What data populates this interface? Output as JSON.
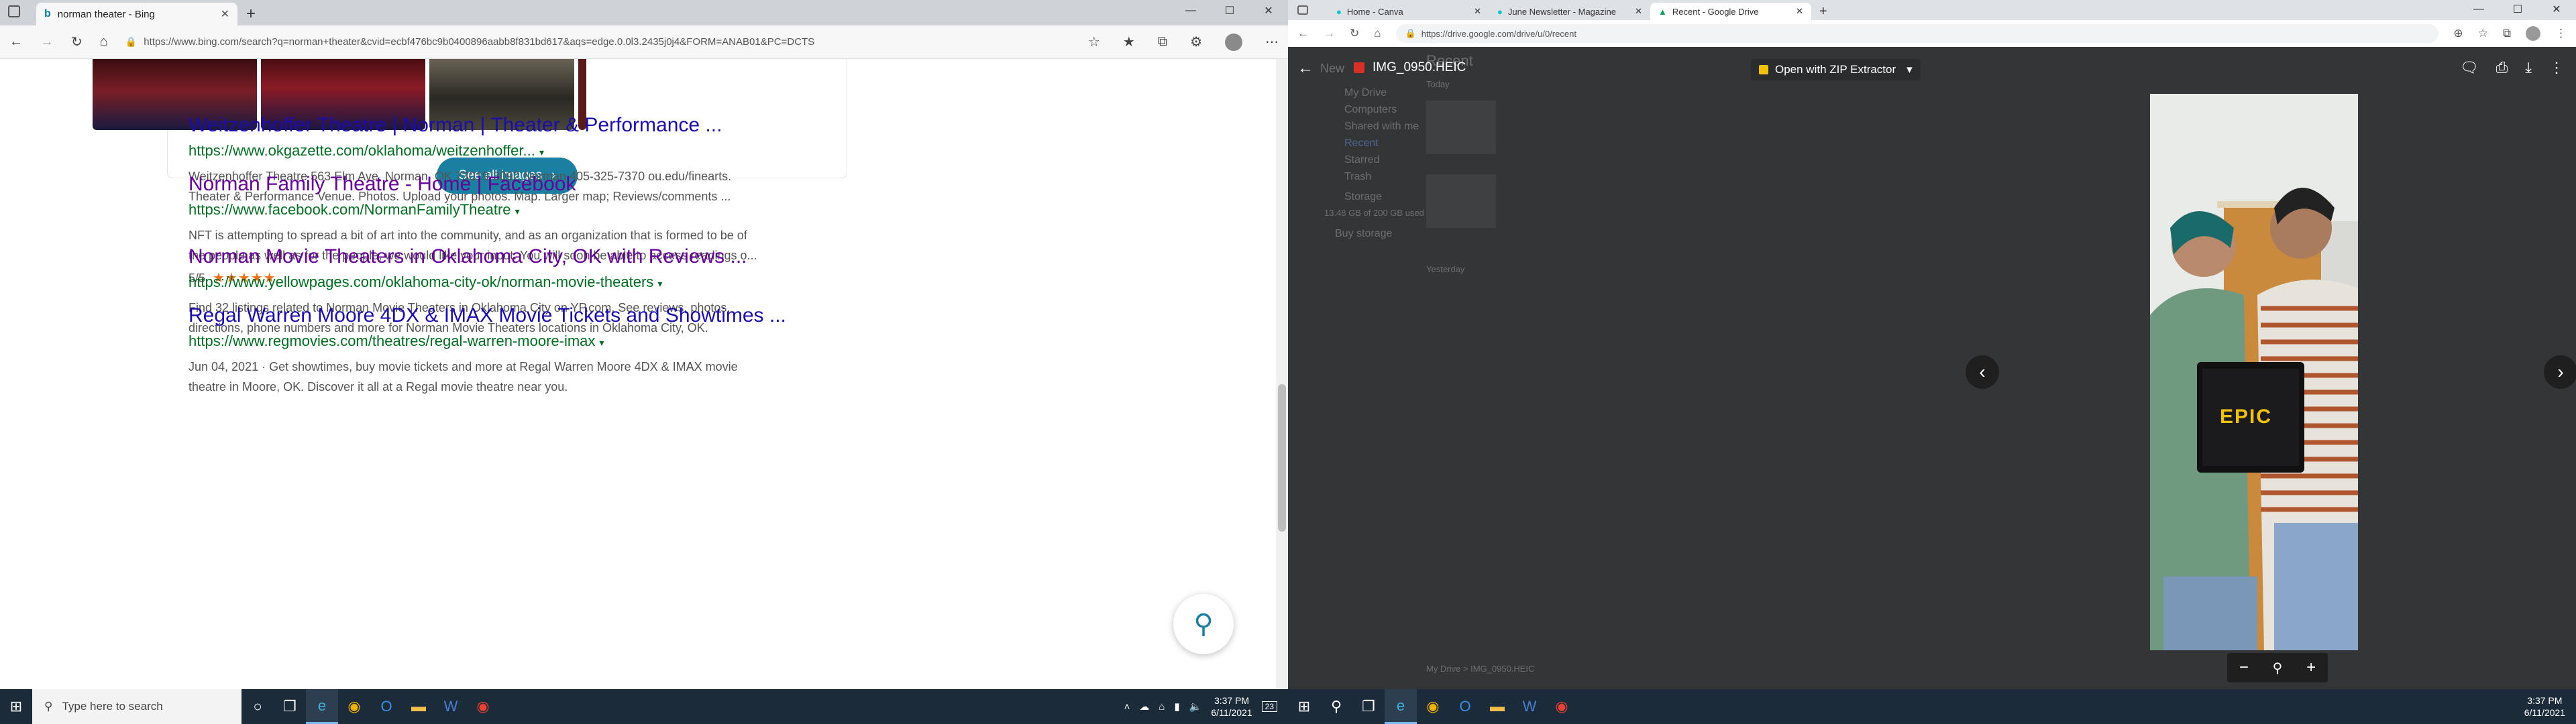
{
  "left_window": {
    "tab": {
      "title": "norman theater - Bing"
    },
    "address": {
      "url": "https://www.bing.com/search?q=norman+theater&cvid=ecbf476bc9b0400896aabb8f831bd617&aqs=edge.0.0l3.2435j0j4&FORM=ANAB01&PC=DCTS"
    },
    "images": {
      "see_all_label": "See all images"
    },
    "results": [
      {
        "title": "Weitzenhoffer Theatre | Norman | Theater & Performance ...",
        "url": "https://www.okgazette.com/oklahoma/weitzenhoffer...",
        "snippet_1": "Weitzenhoffer Theatre 563 Elm Ave. Norman, OK 73019-3092 Norman 405-325-7370 ou.edu/finearts.",
        "snippet_2": "Theater & Performance Venue. Photos. Upload your photos. Map. Larger map; Reviews/comments ..."
      },
      {
        "title": "Norman Family Theatre - Home | Facebook",
        "url": "https://www.facebook.com/NormanFamilyTheatre",
        "snippet_1": "NFT is attempting to spread a bit of art into the community, and as an organization that is formed to be of",
        "snippet_2": "the people as well as for the people, we would like your input. You will soon be able to access readings o...",
        "rating": "5/5",
        "stars": "★★★★★"
      },
      {
        "title": "Norman Movie Theaters in Oklahoma City, OK with Reviews ...",
        "url": "https://www.yellowpages.com/oklahoma-city-ok/norman-movie-theaters",
        "snippet_1": "Find 32 listings related to Norman Movie Theaters in Oklahoma City on YP.com. See reviews, photos,",
        "snippet_2": "directions, phone numbers and more for Norman Movie Theaters locations in Oklahoma City, OK."
      },
      {
        "title": "Regal Warren Moore 4DX & IMAX Movie Tickets and Showtimes ...",
        "url": "https://www.regmovies.com/theatres/regal-warren-moore-imax",
        "snippet_1": "Jun 04, 2021 · Get showtimes, buy movie tickets and more at Regal Warren Moore 4DX & IMAX movie",
        "snippet_2": "theatre in Moore, OK. Discover it all at a Regal movie theatre near you."
      }
    ],
    "taskbar": {
      "search_placeholder": "Type here to search",
      "time": "3:37 PM",
      "date": "6/11/2021",
      "notifications": "23"
    }
  },
  "right_window": {
    "tabs": [
      {
        "title": "Home - Canva"
      },
      {
        "title": "June Newsletter - Magazine"
      },
      {
        "title": "Recent - Google Drive"
      }
    ],
    "address": {
      "url": "https://drive.google.com/drive/u/0/recent"
    },
    "viewer": {
      "file_name": "IMG_0950.HEIC",
      "open_with": "Open with ZIP Extractor",
      "photo_sign_text": "EPIC"
    },
    "drive_background": {
      "new_button": "New",
      "nav": [
        "My Drive",
        "Computers",
        "Shared with me",
        "Recent",
        "Starred",
        "Trash",
        "Storage"
      ],
      "heading": "Recent",
      "section_today": "Today",
      "section_yesterday": "Yesterday",
      "storage_text": "13.48 GB of 200 GB used",
      "buy_storage": "Buy storage",
      "breadcrumb": "My Drive > IMG_0950.HEIC"
    },
    "taskbar": {
      "time": "3:37 PM",
      "date": "6/11/2021"
    }
  },
  "colors": {
    "bing_link": "#1a0dab",
    "bing_visited": "#660099",
    "bing_url": "#006d21",
    "bing_accent": "#1a7fa0",
    "star": "#e7711b"
  }
}
